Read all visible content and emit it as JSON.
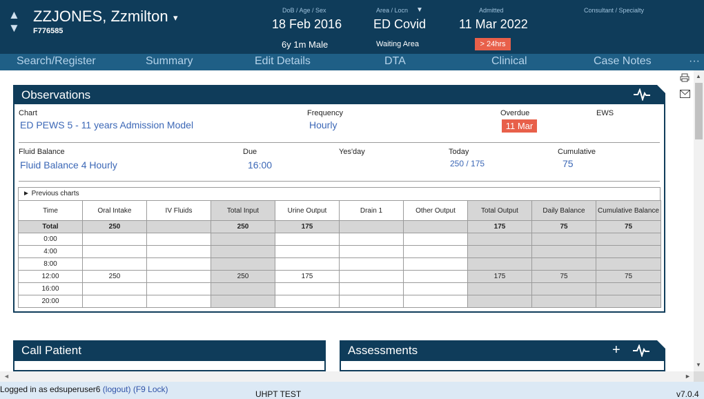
{
  "patient": {
    "name": "ZZJONES, Zzmilton",
    "name_caret": "▾",
    "id": "F776585",
    "nav_up": "▲",
    "nav_down": "▼"
  },
  "header": {
    "dob_label": "DoB / Age / Sex",
    "dob": "18 Feb 2016",
    "age_sex": "6y 1m Male",
    "area_label": "Area / Locn",
    "area_caret": "▼",
    "area": "ED Covid",
    "location": "Waiting Area",
    "admitted_label": "Admitted",
    "admitted": "11 Mar 2022",
    "admitted_badge": "> 24hrs",
    "consultant_label": "Consultant / Specialty"
  },
  "nav": {
    "items": [
      "Search/Register",
      "Summary",
      "Edit Details",
      "DTA",
      "Clinical",
      "Case Notes"
    ],
    "more": "···"
  },
  "observations": {
    "title": "Observations",
    "chart_label": "Chart",
    "chart_value": "ED PEWS 5 - 11 years Admission Model",
    "frequency_label": "Frequency",
    "frequency_value": "Hourly",
    "overdue_label": "Overdue",
    "overdue_value": "11 Mar",
    "ews_label": "EWS",
    "fluid_label": "Fluid Balance",
    "fluid_value": "Fluid Balance 4 Hourly",
    "due_label": "Due",
    "due_value": "16:00",
    "yesday_label": "Yes'day",
    "today_label": "Today",
    "today_value": "250 / 175",
    "cumulative_label": "Cumulative",
    "cumulative_value": "75",
    "previous_charts": "► Previous charts",
    "table": {
      "headers": [
        "Time",
        "Oral Intake",
        "IV Fluids",
        "Total Input",
        "Urine Output",
        "Drain 1",
        "Other Output",
        "Total Output",
        "Daily Balance",
        "Cumulative Balance"
      ],
      "total_row": [
        "Total",
        "250",
        "",
        "250",
        "175",
        "",
        "",
        "175",
        "75",
        "75"
      ],
      "rows": [
        [
          "0:00",
          "",
          "",
          "",
          "",
          "",
          "",
          "",
          "",
          ""
        ],
        [
          "4:00",
          "",
          "",
          "",
          "",
          "",
          "",
          "",
          "",
          ""
        ],
        [
          "8:00",
          "",
          "",
          "",
          "",
          "",
          "",
          "",
          "",
          ""
        ],
        [
          "12:00",
          "250",
          "",
          "250",
          "175",
          "",
          "",
          "175",
          "75",
          "75"
        ],
        [
          "16:00",
          "",
          "",
          "",
          "",
          "",
          "",
          "",
          "",
          ""
        ],
        [
          "20:00",
          "",
          "",
          "",
          "",
          "",
          "",
          "",
          "",
          ""
        ]
      ]
    }
  },
  "call_patient": {
    "title": "Call Patient"
  },
  "assessments": {
    "title": "Assessments",
    "add": "+"
  },
  "status": {
    "logged_in": "Logged in as edsuperuser6",
    "logout": "(logout)",
    "f9": "(F9",
    "lock": "Lock)",
    "env": "UHPT TEST",
    "version": "v7.0.4"
  },
  "colors": {
    "header_bg": "#0f3c5a",
    "nav_bg": "#1f5f86",
    "alert": "#e8604a",
    "link": "#3b67b6"
  }
}
